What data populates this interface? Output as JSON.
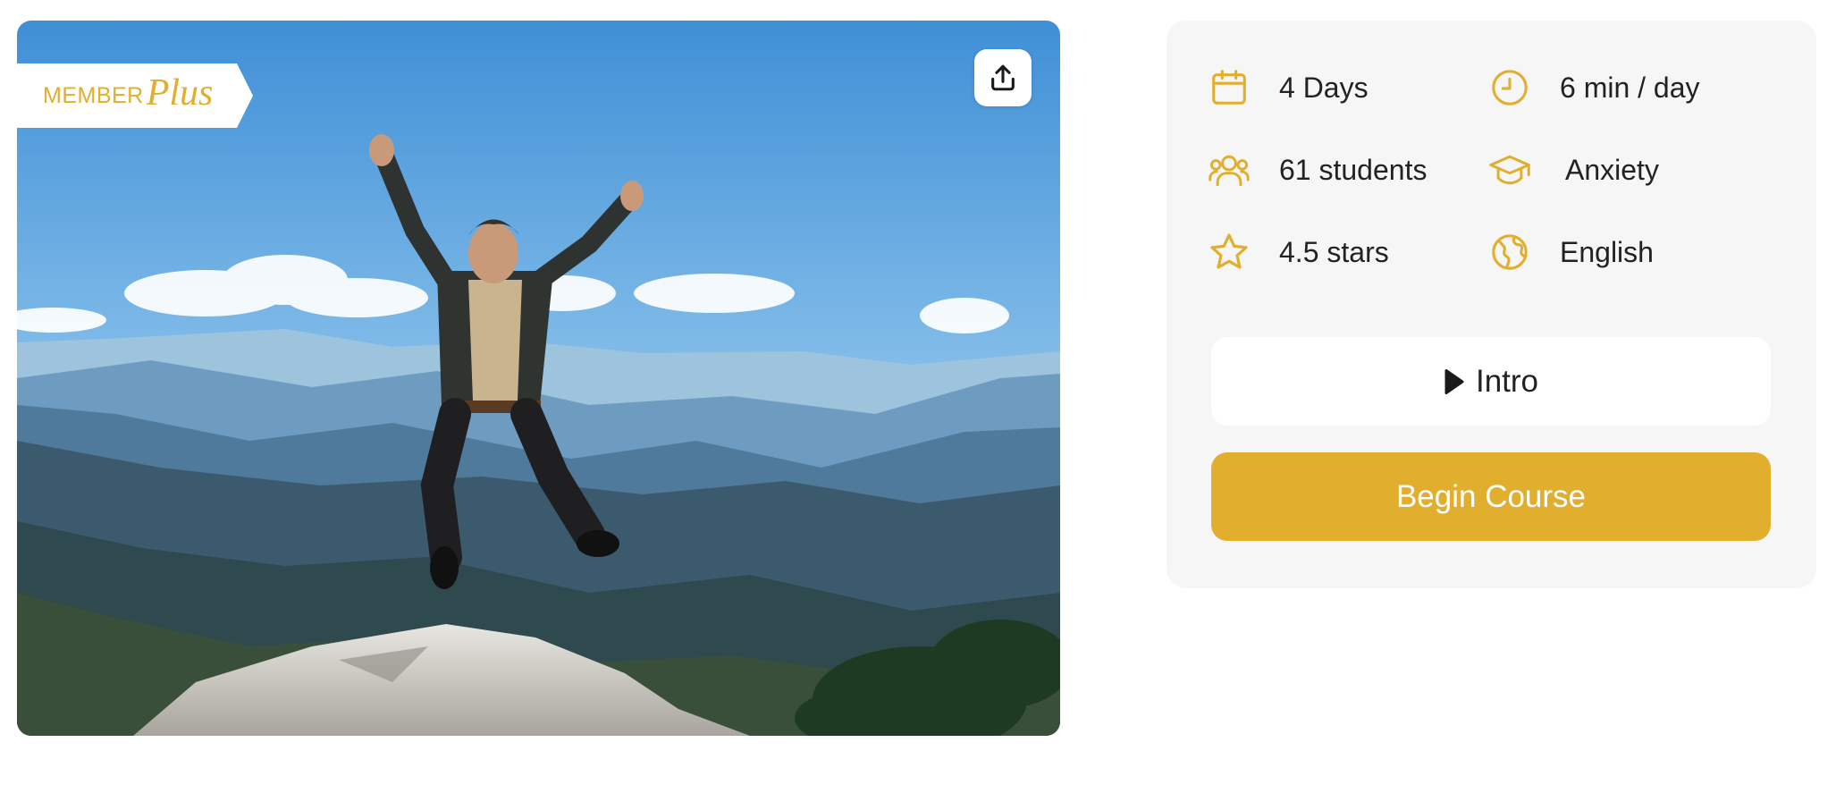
{
  "hero": {
    "badge": {
      "member": "MEMBER",
      "plus": "Plus"
    },
    "share_icon": "share-upload-icon"
  },
  "course": {
    "stats": [
      {
        "icon": "calendar-icon",
        "label": "4 Days"
      },
      {
        "icon": "clock-icon",
        "label": "6 min / day"
      },
      {
        "icon": "students-icon",
        "label": "61 students"
      },
      {
        "icon": "graduation-cap-icon",
        "label": "Anxiety"
      },
      {
        "icon": "star-icon",
        "label": "4.5 stars"
      },
      {
        "icon": "globe-icon",
        "label": "English"
      }
    ],
    "intro_label": "Intro",
    "begin_label": "Begin Course"
  },
  "colors": {
    "accent": "#E1AE2E",
    "card_background": "#F5F6F5",
    "text": "#222222"
  }
}
